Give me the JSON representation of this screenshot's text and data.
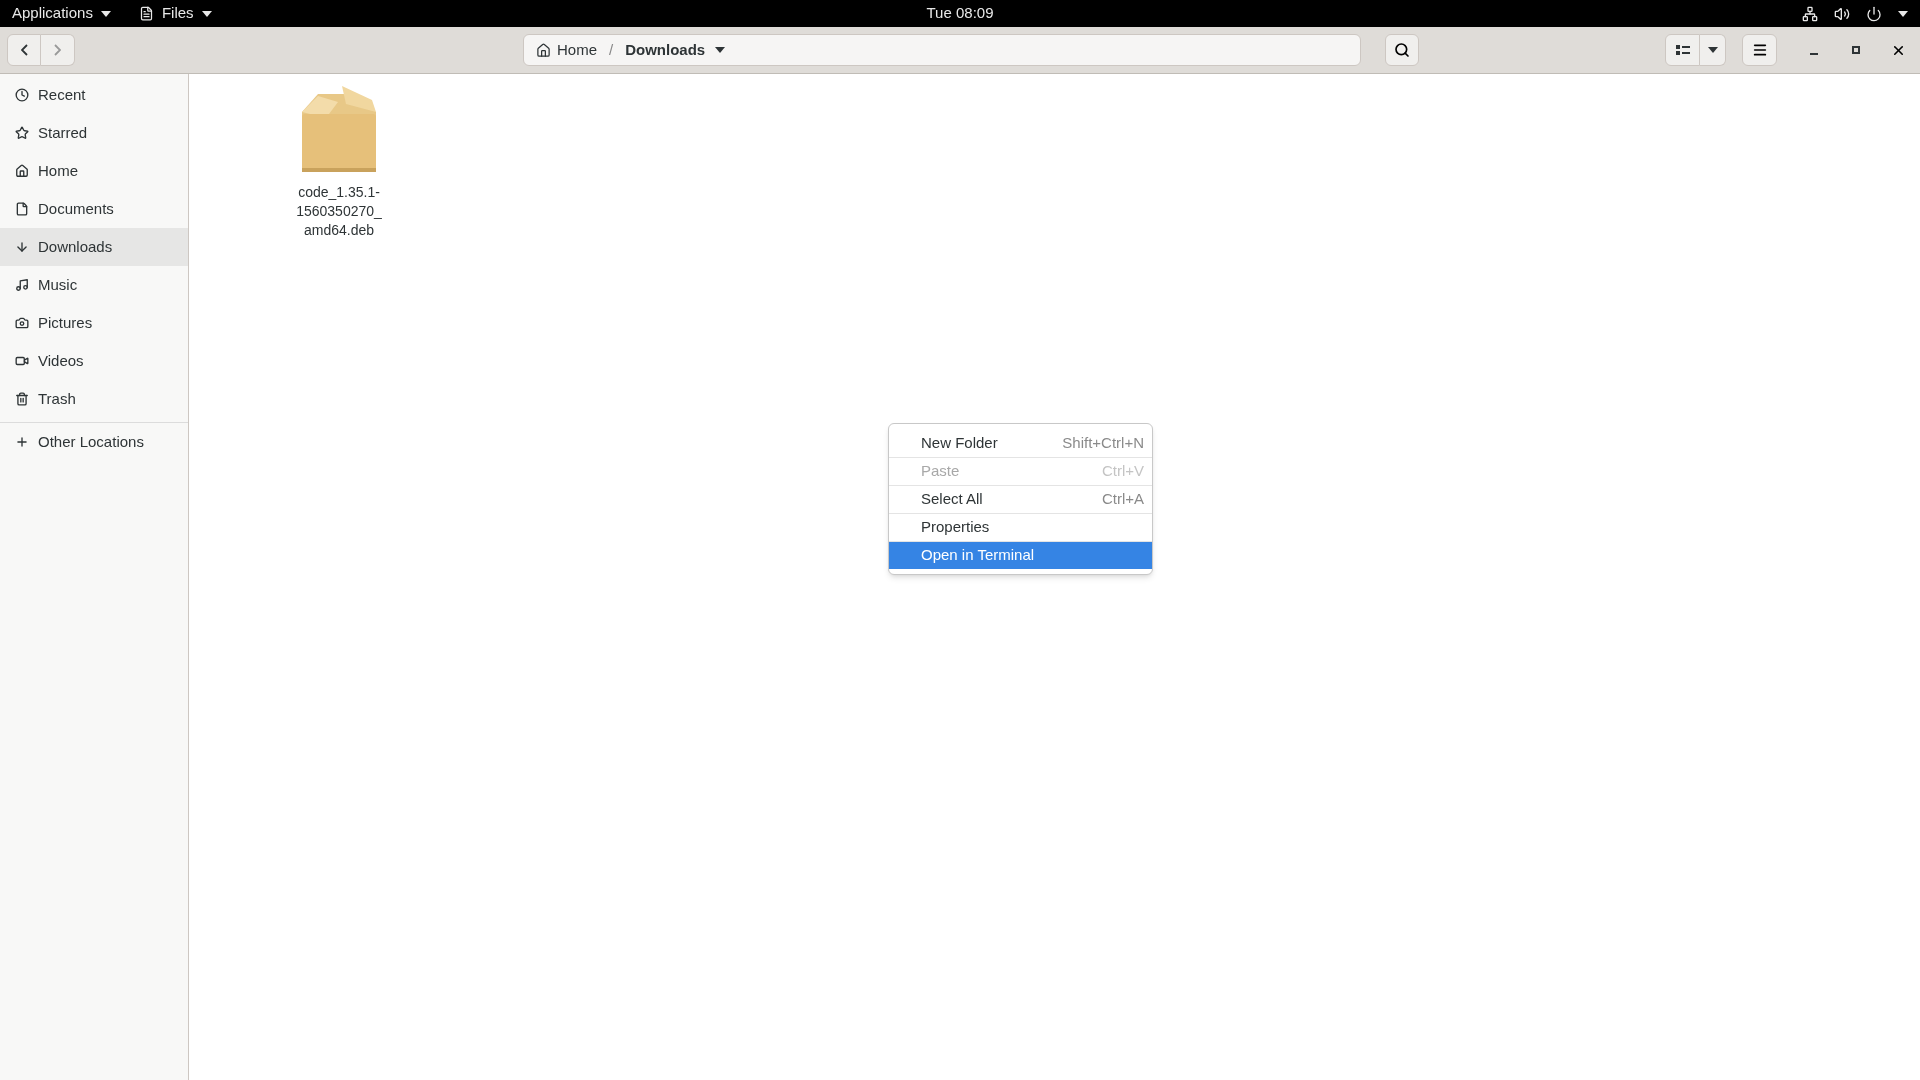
{
  "top_bar": {
    "applications_menu": "Applications",
    "app_menu": "Files",
    "clock": "Tue 08:09"
  },
  "header_bar": {
    "back_disabled": false,
    "forward_disabled": true,
    "path": [
      {
        "label": "Home",
        "kind": "home"
      },
      {
        "label": "/",
        "kind": "separator"
      },
      {
        "label": "Downloads",
        "kind": "current"
      }
    ]
  },
  "sidebar": {
    "items": [
      {
        "label": "Recent",
        "selected": false
      },
      {
        "label": "Starred",
        "selected": false
      },
      {
        "label": "Home",
        "selected": false
      },
      {
        "label": "Documents",
        "selected": false
      },
      {
        "label": "Downloads",
        "selected": true
      },
      {
        "label": "Music",
        "selected": false
      },
      {
        "label": "Pictures",
        "selected": false
      },
      {
        "label": "Videos",
        "selected": false
      },
      {
        "label": "Trash",
        "selected": false
      }
    ],
    "other_locations": "Other Locations"
  },
  "files": [
    {
      "name": "code_1.35.1-1560350270_amd64.deb",
      "kind": "package"
    }
  ],
  "context_menu": [
    {
      "label": "New Folder",
      "shortcut": "Shift+Ctrl+N",
      "disabled": false,
      "selected": false
    },
    {
      "label": "Paste",
      "shortcut": "Ctrl+V",
      "disabled": true,
      "selected": false
    },
    {
      "label": "Select All",
      "shortcut": "Ctrl+A",
      "disabled": false,
      "selected": false
    },
    {
      "label": "Properties",
      "disabled": false,
      "selected": false
    },
    {
      "label": "Open in Terminal",
      "disabled": false,
      "selected": true
    }
  ]
}
